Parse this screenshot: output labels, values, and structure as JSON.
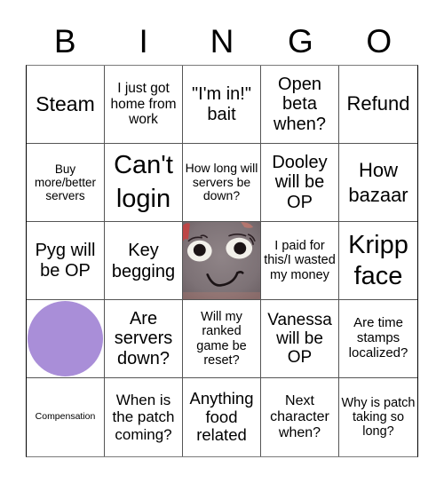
{
  "title_letters": [
    "B",
    "I",
    "N",
    "G",
    "O"
  ],
  "colors": {
    "marker": "#A98ED8",
    "grid_line": "#555555"
  },
  "cells": [
    {
      "text": "Steam"
    },
    {
      "text": "I just got home from work"
    },
    {
      "text": "\"I'm in!\" bait"
    },
    {
      "text": "Open beta when?"
    },
    {
      "text": "Refund"
    },
    {
      "text": "Buy more/better servers"
    },
    {
      "text": "Can't login"
    },
    {
      "text": "How long will servers be down?"
    },
    {
      "text": "Dooley will be OP"
    },
    {
      "text": "How bazaar"
    },
    {
      "text": "Pyg will be OP"
    },
    {
      "text": "Key begging"
    },
    {
      "text": "",
      "image": "puppet-face-free-space"
    },
    {
      "text": "I paid for this/I wasted my money"
    },
    {
      "text": "Kripp face"
    },
    {
      "text": "",
      "marked": true
    },
    {
      "text": "Are servers down?"
    },
    {
      "text": "Will my ranked game be reset?"
    },
    {
      "text": "Vanessa will be OP"
    },
    {
      "text": "Are time stamps localized?"
    },
    {
      "text": "Compensation"
    },
    {
      "text": "When is the patch coming?"
    },
    {
      "text": "Anything food related"
    },
    {
      "text": "Next character when?"
    },
    {
      "text": "Why is patch taking so long?"
    }
  ]
}
